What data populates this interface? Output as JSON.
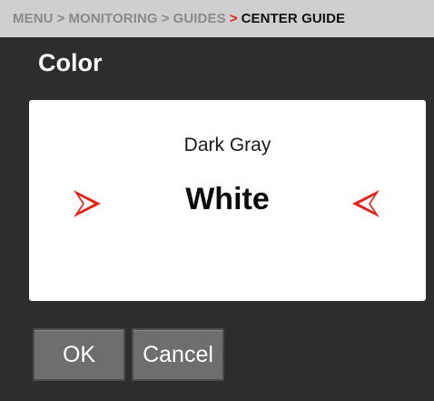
{
  "breadcrumb": {
    "items": [
      "MENU",
      "MONITORING",
      "GUIDES",
      "CENTER GUIDE"
    ],
    "separator": ">"
  },
  "dialog": {
    "title": "Color",
    "previous_option": "Dark Gray",
    "current_option": "White"
  },
  "buttons": {
    "ok_label": "OK",
    "cancel_label": "Cancel"
  },
  "icons": {
    "left": "chevron-right-icon",
    "right": "chevron-left-icon"
  },
  "colors": {
    "accent": "#e0241b",
    "background": "#2d2d2d",
    "breadcrumb_bg": "#cfcfcf",
    "button_bg": "#6e6e6e"
  }
}
